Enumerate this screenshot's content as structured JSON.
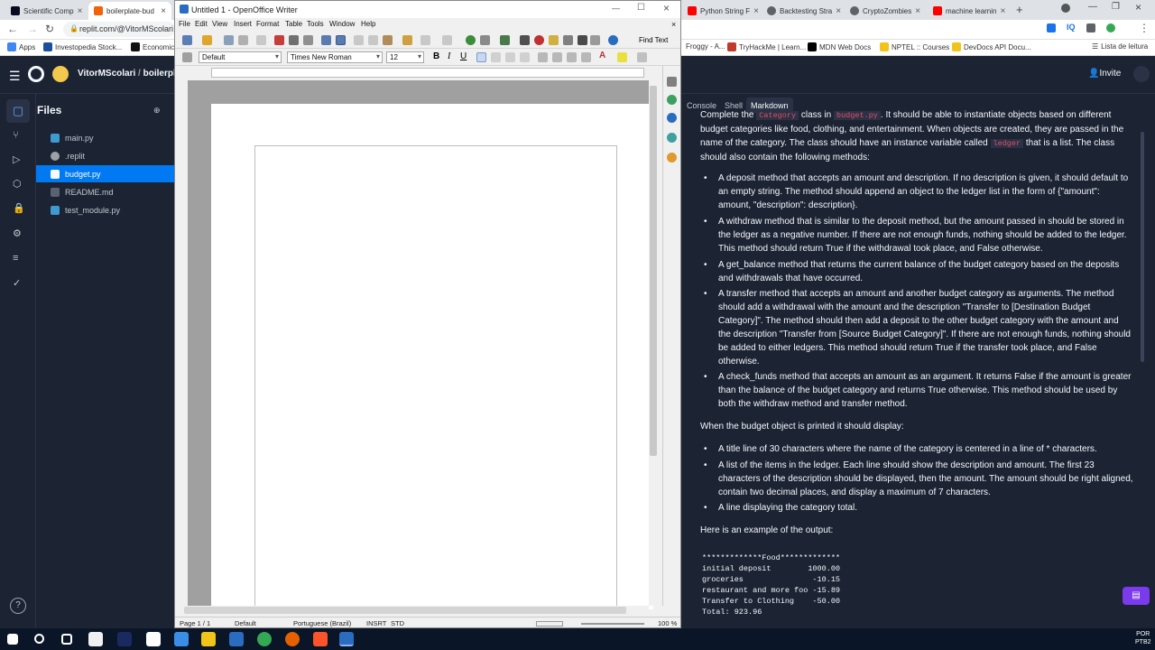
{
  "chrome": {
    "tabs": [
      {
        "label": "Scientific Comp",
        "icon": "fcc-icon",
        "color": "#0a0a23"
      },
      {
        "label": "boilerplate-bud",
        "icon": "replit-icon",
        "color": "#f26207",
        "active": true
      },
      {
        "label": "Python String F",
        "icon": "youtube-icon",
        "color": "#ff0000"
      },
      {
        "label": "Backtesting Stra",
        "icon": "globe-icon",
        "color": "#5f6368"
      },
      {
        "label": "CryptoZombies",
        "icon": "globe-icon",
        "color": "#5f6368"
      },
      {
        "label": "machine learnin",
        "icon": "youtube-icon",
        "color": "#ff0000"
      }
    ],
    "url": "replit.com/@VitorMScolari",
    "bookmarks": [
      "Apps",
      "Investopedia Stock...",
      "Economic",
      "Froggy - A...",
      "TryHackMe | Learn...",
      "MDN Web Docs",
      "NPTEL :: Courses",
      "DevDocs API Docu...",
      "Lista de leitura"
    ]
  },
  "replit": {
    "user": "VitorMScolari",
    "repl": "boilerplate",
    "invite": "Invite",
    "files_title": "Files",
    "files": [
      {
        "name": "main.py",
        "icon": "python-icon"
      },
      {
        "name": ".replit",
        "icon": "gear-icon"
      },
      {
        "name": "budget.py",
        "icon": "python-icon",
        "selected": true
      },
      {
        "name": "README.md",
        "icon": "markdown-icon"
      },
      {
        "name": "test_module.py",
        "icon": "python-icon"
      }
    ],
    "right_tabs": [
      "Console",
      "Shell",
      "Markdown"
    ],
    "md": {
      "intro_a": "Complete the ",
      "intro_code1": "Category",
      "intro_b": " class in ",
      "intro_code2": "budget.py",
      "intro_c": ". It should be able to instantiate objects based on different budget categories like food, clothing, and entertainment. When objects are created, they are passed in the name of the category. The class should have an instance variable called ",
      "intro_code3": "ledger",
      "intro_d": " that is a list. The class should also contain the following methods:",
      "b1": "A deposit method that accepts an amount and description. If no description is given, it should default to an empty string. The method should append an object to the ledger list in the form of {\"amount\": amount, \"description\": description}.",
      "b2": "A withdraw method that is similar to the deposit method, but the amount passed in should be stored in the ledger as a negative number. If there are not enough funds, nothing should be added to the ledger. This method should return True if the withdrawal took place, and False otherwise.",
      "b3": "A get_balance method that returns the current balance of the budget category based on the deposits and withdrawals that have occurred.",
      "b4": "A transfer method that accepts an amount and another budget category as arguments. The method should add a withdrawal with the amount and the description \"Transfer to [Destination Budget Category]\". The method should then add a deposit to the other budget category with the amount and the description \"Transfer from [Source Budget Category]\". If there are not enough funds, nothing should be added to either ledgers. This method should return True if the transfer took place, and False otherwise.",
      "b5": "A check_funds method that accepts an amount as an argument. It returns False if the amount is greater than the balance of the budget category and returns True otherwise. This method should be used by both the withdraw method and transfer method.",
      "print_intro": "When the budget object is printed it should display:",
      "p1": "A title line of 30 characters where the name of the category is centered in a line of * characters.",
      "p2": "A list of the items in the ledger. Each line should show the description and amount. The first 23 characters of the description should be displayed, then the amount. The amount should be right aligned, contain two decimal places, and display a maximum of 7 characters.",
      "p3": "A line displaying the category total.",
      "example_intro": "Here is an example of the output:",
      "example": "*************Food*************\ninitial deposit        1000.00\ngroceries               -10.15\nrestaurant and more foo -15.89\nTransfer to Clothing    -50.00\nTotal: 923.96"
    }
  },
  "writer": {
    "title": "Untitled 1 - OpenOffice Writer",
    "menu": [
      "File",
      "Edit",
      "View",
      "Insert",
      "Format",
      "Table",
      "Tools",
      "Window",
      "Help"
    ],
    "find_text": "Find Text",
    "style": "Default",
    "font": "Times New Roman",
    "size": "12",
    "status": {
      "page": "Page 1 / 1",
      "style": "Default",
      "lang": "Portuguese (Brazil)",
      "insrt": "INSRT",
      "std": "STD",
      "zoom": "100 %"
    }
  },
  "taskbar": {
    "lang": "POR",
    "layout": "PTB2"
  }
}
